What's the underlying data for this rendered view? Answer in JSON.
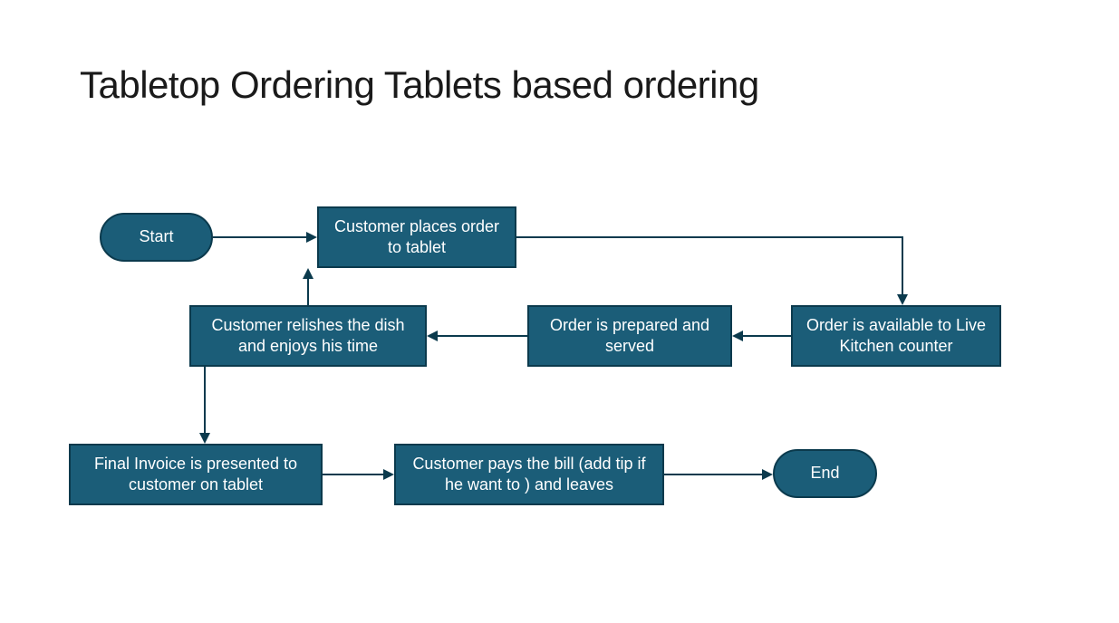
{
  "title": "Tabletop Ordering Tablets based ordering",
  "nodes": {
    "start": "Start",
    "place_order": "Customer places order to tablet",
    "kitchen": "Order is available to Live Kitchen counter",
    "prepared": "Order is prepared and served",
    "relish": "Customer relishes the dish and enjoys  his time",
    "invoice": "Final Invoice is presented to customer on tablet",
    "pay": "Customer pays the bill (add tip if he want to ) and  leaves",
    "end": "End"
  },
  "colors": {
    "node_fill": "#1b5d78",
    "node_border": "#0b3a4d",
    "arrow": "#0b3a4d"
  }
}
